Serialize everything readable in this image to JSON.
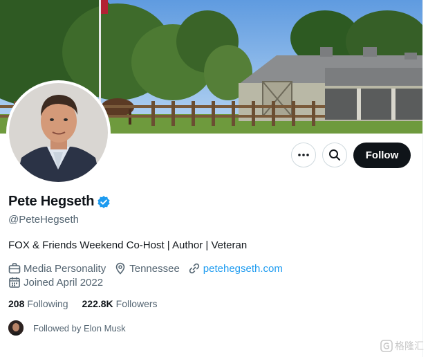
{
  "profile": {
    "name": "Pete Hegseth",
    "handle": "@PeteHegseth",
    "bio": "FOX & Friends Weekend Co-Host | Author | Veteran",
    "category": "Media Personality",
    "location": "Tennessee",
    "website": "petehegseth.com",
    "joined": "Joined April 2022",
    "verified_icon": "verified-badge-icon"
  },
  "actions": {
    "more_icon": "more-horizontal-icon",
    "search_icon": "search-icon",
    "follow_label": "Follow"
  },
  "stats": {
    "following_count": "208",
    "following_label": "Following",
    "followers_count": "222.8K",
    "followers_label": "Followers"
  },
  "followed_by": {
    "text": "Followed by Elon Musk"
  },
  "watermark": {
    "text": "格隆汇"
  },
  "colors": {
    "accent": "#1d9bf0",
    "primary_text": "#0f1419",
    "secondary_text": "#536471",
    "follow_button": "#0f1419"
  }
}
